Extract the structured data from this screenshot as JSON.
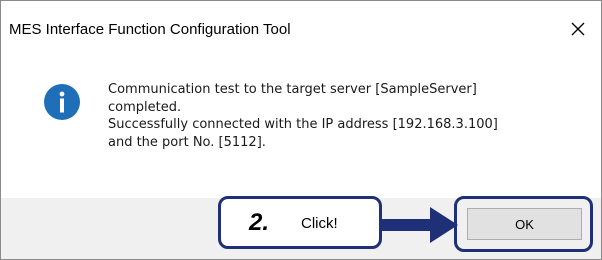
{
  "window": {
    "title": "MES Interface Function Configuration Tool",
    "close_icon": "close-icon"
  },
  "message": {
    "icon": "info-icon",
    "lines": [
      "Communication test to the target server [SampleServer]",
      "completed.",
      "Successfully connected with the IP address [192.168.3.100]",
      "and the port No. [5112]."
    ]
  },
  "annotation": {
    "step_number": "2.",
    "step_text": "Click!",
    "color": "#1f2f78"
  },
  "buttons": {
    "ok_label": "OK"
  },
  "colors": {
    "info_icon": "#1f6fb8",
    "footer_bg": "#f0f0f0"
  }
}
